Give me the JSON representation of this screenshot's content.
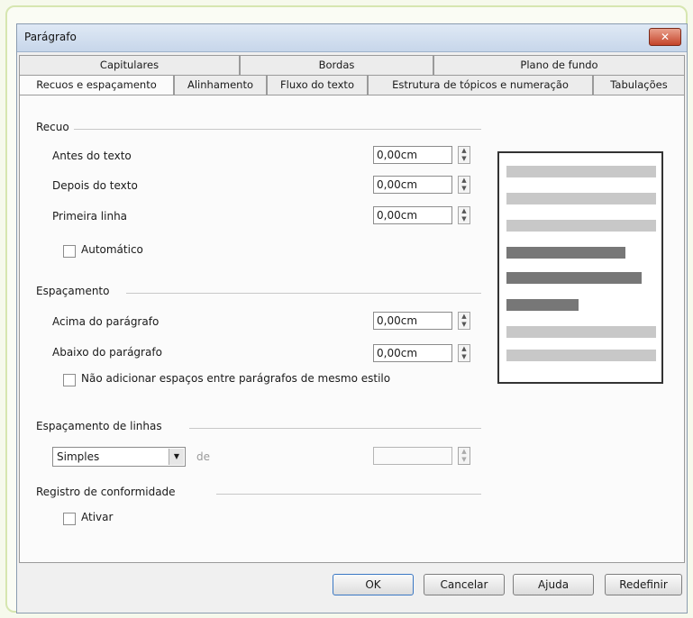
{
  "window": {
    "title": "Parágrafo",
    "close_symbol": "✕"
  },
  "tabs_row1": [
    "Capitulares",
    "Bordas",
    "Plano de fundo"
  ],
  "tabs_row2": [
    "Recuos e espaçamento",
    "Alinhamento",
    "Fluxo do texto",
    "Estrutura de tópicos e numeração",
    "Tabulações"
  ],
  "active_tab": "Recuos e espaçamento",
  "recuo": {
    "title": "Recuo",
    "before_label": "Antes do texto",
    "before_value": "0,00cm",
    "after_label": "Depois do texto",
    "after_value": "0,00cm",
    "first_label": "Primeira linha",
    "first_value": "0,00cm",
    "auto_label": "Automático"
  },
  "espacamento": {
    "title": "Espaçamento",
    "above_label": "Acima do parágrafo",
    "above_value": "0,00cm",
    "below_label": "Abaixo do parágrafo",
    "below_value": "0,00cm",
    "no_space_label": "Não adicionar espaços entre parágrafos de mesmo estilo"
  },
  "linhas": {
    "title": "Espaçamento de linhas",
    "selected": "Simples",
    "de_label": "de"
  },
  "registro": {
    "title": "Registro de conformidade",
    "activate_label": "Ativar"
  },
  "buttons": {
    "ok": "OK",
    "cancel": "Cancelar",
    "help": "Ajuda",
    "reset": "Redefinir"
  },
  "preview": {
    "bars": [
      "light",
      "light",
      "light",
      "dark",
      "dark",
      "dark",
      "light",
      "light",
      "light"
    ]
  }
}
